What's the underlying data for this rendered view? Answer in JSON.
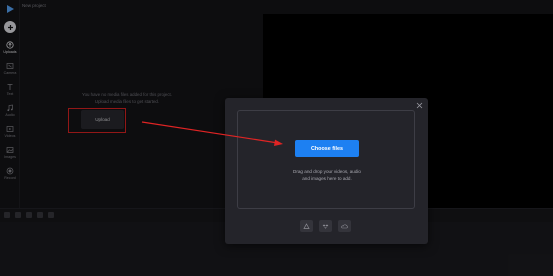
{
  "app": {
    "project_title": "New project"
  },
  "sidebar": {
    "items": [
      {
        "label": "Uploads",
        "icon": "upload-icon",
        "active": true
      },
      {
        "label": "Camera",
        "icon": "camera-icon"
      },
      {
        "label": "Text",
        "icon": "text-icon"
      },
      {
        "label": "Audio",
        "icon": "music-icon"
      },
      {
        "label": "Videos",
        "icon": "video-icon"
      },
      {
        "label": "Images",
        "icon": "image-icon"
      },
      {
        "label": "Record",
        "icon": "record-icon"
      }
    ]
  },
  "media_panel": {
    "empty_line1": "You have no media files added for this project.",
    "empty_line2": "Upload media files to get started.",
    "upload_label": "Upload"
  },
  "modal": {
    "choose_label": "Choose files",
    "drop_line1": "Drag and drop your videos, audio",
    "drop_line2": "and images here to add.",
    "sources": [
      "google-drive-icon",
      "dropbox-icon",
      "onedrive-icon"
    ]
  },
  "colors": {
    "accent": "#1d80f2",
    "annotation": "#e02424",
    "background": "#141417",
    "modal": "#24242a"
  }
}
